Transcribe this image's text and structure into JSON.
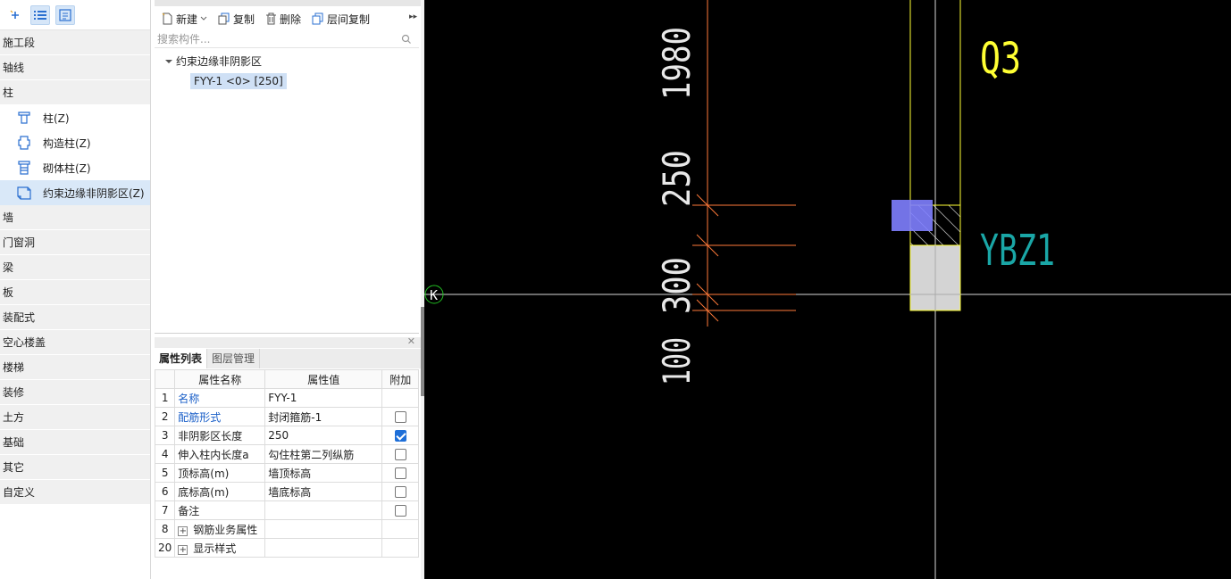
{
  "nav": {
    "categories_top": [
      "施工段",
      "轴线",
      "柱"
    ],
    "column_items": [
      {
        "label": "柱(Z)",
        "icon": "column-icon"
      },
      {
        "label": "构造柱(Z)",
        "icon": "construction-column-icon"
      },
      {
        "label": "砌体柱(Z)",
        "icon": "masonry-column-icon"
      },
      {
        "label": "约束边缘非阴影区(Z)",
        "icon": "constraint-edge-icon"
      }
    ],
    "categories_bottom": [
      "墙",
      "门窗洞",
      "梁",
      "板",
      "装配式",
      "空心楼盖",
      "楼梯",
      "装修",
      "土方",
      "基础",
      "其它",
      "自定义"
    ],
    "selected": "约束边缘非阴影区(Z)"
  },
  "toolbar": {
    "new": "新建",
    "copy": "复制",
    "delete": "删除",
    "floor_copy": "层间复制"
  },
  "search": {
    "placeholder": "搜索构件..."
  },
  "tree": {
    "root": "约束边缘非阴影区",
    "child": "FYY-1 <0> [250]"
  },
  "props": {
    "tabs": [
      "属性列表",
      "图层管理"
    ],
    "columns": [
      "属性名称",
      "属性值",
      "附加"
    ],
    "rows": [
      {
        "idx": "1",
        "name": "名称",
        "value": "FYY-1",
        "blue": true,
        "checkbox": "none"
      },
      {
        "idx": "2",
        "name": "配筋形式",
        "value": "封闭箍筋-1",
        "blue": true,
        "checkbox": "off"
      },
      {
        "idx": "3",
        "name": "非阴影区长度",
        "value": "250",
        "blue": false,
        "checkbox": "on"
      },
      {
        "idx": "4",
        "name": "伸入柱内长度a",
        "value": "勾住柱第二列纵筋",
        "blue": false,
        "checkbox": "off"
      },
      {
        "idx": "5",
        "name": "顶标高(m)",
        "value": "墙顶标高",
        "blue": false,
        "checkbox": "off"
      },
      {
        "idx": "6",
        "name": "底标高(m)",
        "value": "墙底标高",
        "blue": false,
        "checkbox": "off"
      },
      {
        "idx": "7",
        "name": "备注",
        "value": "",
        "blue": false,
        "checkbox": "off"
      },
      {
        "idx": "8",
        "name": "钢筋业务属性",
        "value": "",
        "blue": false,
        "checkbox": "none",
        "expander": true
      },
      {
        "idx": "20",
        "name": "显示样式",
        "value": "",
        "blue": false,
        "checkbox": "none",
        "expander": true
      }
    ]
  },
  "canvas": {
    "dims": [
      "1980",
      "250",
      "300",
      "100"
    ],
    "label_q3": "Q3",
    "label_ybz1": "YBZ1",
    "axis_label": "K",
    "colors": {
      "bg": "#000000",
      "orange": "#ff7a3a",
      "yellow": "#ffff33",
      "teal": "#1aa6a6",
      "white": "#e8e8e8",
      "blue_sel": "#8080ff",
      "green": "#22c022"
    }
  }
}
